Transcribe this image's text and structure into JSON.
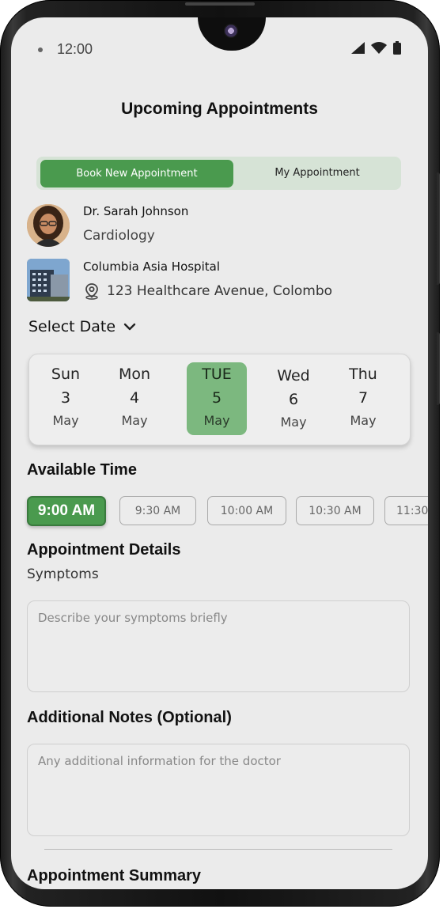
{
  "status": {
    "time": "12:00"
  },
  "page": {
    "title": "Upcoming Appointments"
  },
  "tabs": {
    "active_label": "Book New Appointment",
    "inactive_label": "My Appointment"
  },
  "doctor": {
    "name": "Dr. Sarah Johnson",
    "specialty": "Cardiology"
  },
  "hospital": {
    "name": "Columbia Asia Hospital",
    "address": "123 Healthcare Avenue, Colombo"
  },
  "select_date": {
    "label": "Select Date"
  },
  "dates": [
    {
      "day": "Sun",
      "num": "3",
      "month": "May",
      "selected": false
    },
    {
      "day": "Mon",
      "num": "4",
      "month": "May",
      "selected": false
    },
    {
      "day": "TUE",
      "num": "5",
      "month": "May",
      "selected": true
    },
    {
      "day": "Wed",
      "num": "6",
      "month": "May",
      "selected": false
    },
    {
      "day": "Thu",
      "num": "7",
      "month": "May",
      "selected": false
    }
  ],
  "available_time": {
    "label": "Available Time",
    "slots": [
      "9:00 AM",
      "9:30 AM",
      "10:00 AM",
      "10:30 AM",
      "11:30"
    ],
    "selected": "9:00 AM"
  },
  "details": {
    "heading": "Appointment Details",
    "symptoms_label": "Symptoms",
    "symptoms_placeholder": "Describe your symptoms briefly",
    "notes_heading": "Additional Notes (Optional)",
    "notes_placeholder": "Any additional information for the doctor"
  },
  "summary": {
    "heading": "Appointment Summary"
  },
  "colors": {
    "accent": "#4a9a4e",
    "accent_light": "#7cb87f",
    "segment_bg": "#d6e3d6",
    "screen_bg": "#ebebeb"
  },
  "icons": {
    "chevron": "chevron-down-icon",
    "location": "location-pin-icon",
    "signal": "signal-icon",
    "wifi": "wifi-icon",
    "battery": "battery-icon"
  }
}
